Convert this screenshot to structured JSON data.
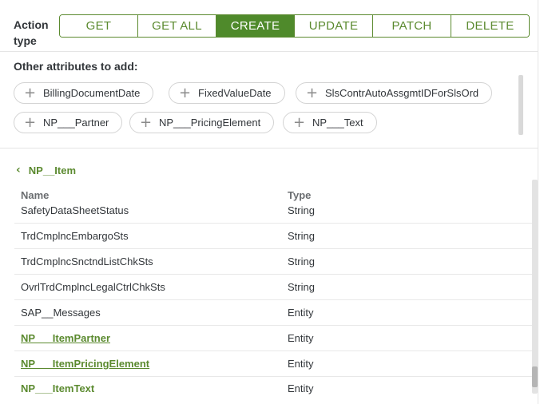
{
  "action": {
    "label": "Action type",
    "buttons": [
      "GET",
      "GET ALL",
      "CREATE",
      "UPDATE",
      "PATCH",
      "DELETE"
    ],
    "active": "CREATE"
  },
  "attributes": {
    "title": "Other attributes to add:",
    "chips": [
      "BillingDocumentDate",
      "FixedValueDate",
      "SlsContrAutoAssgmtIDForSlsOrd",
      "NP___Partner",
      "NP___PricingElement",
      "NP___Text"
    ]
  },
  "entity": {
    "back_label": "NP__Item",
    "col_name": "Name",
    "col_type": "Type",
    "rows": [
      {
        "name": "SafetyDataSheetStatus",
        "type": "String"
      },
      {
        "name": "TrdCmplncEmbargoSts",
        "type": "String"
      },
      {
        "name": "TrdCmplncSnctndListChkSts",
        "type": "String"
      },
      {
        "name": "OvrlTrdCmplncLegalCtrlChkSts",
        "type": "String"
      },
      {
        "name": "SAP__Messages",
        "type": "Entity"
      },
      {
        "name": "NP___ItemPartner",
        "type": "Entity"
      },
      {
        "name": "NP___ItemPricingElement",
        "type": "Entity"
      },
      {
        "name": "NP___ItemText",
        "type": "Entity"
      }
    ]
  }
}
